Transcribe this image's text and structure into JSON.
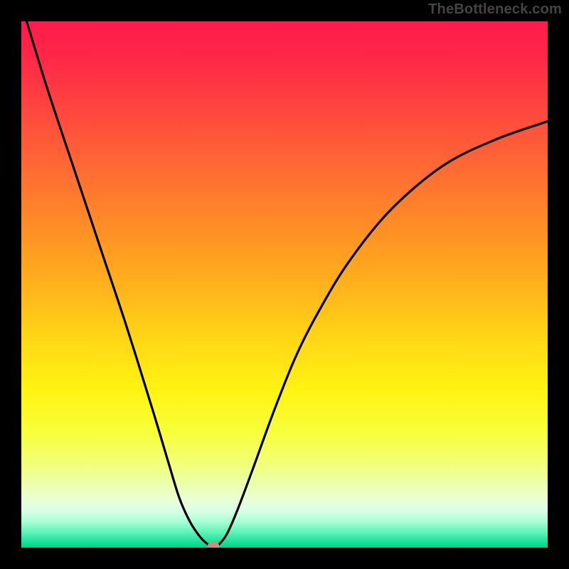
{
  "watermark": "TheBottleneck.com",
  "colors": {
    "page_bg": "#000000",
    "curve": "#000000",
    "marker": "#cf8a7a",
    "watermark_text": "#444444"
  },
  "chart_data": {
    "type": "line",
    "title": "",
    "xlabel": "",
    "ylabel": "",
    "xlim": [
      0,
      1
    ],
    "ylim": [
      0,
      1
    ],
    "grid": false,
    "legend": false,
    "series": [
      {
        "name": "curve",
        "x": [
          0.01,
          0.05,
          0.1,
          0.15,
          0.2,
          0.25,
          0.28,
          0.3,
          0.32,
          0.34,
          0.355,
          0.365,
          0.375,
          0.39,
          0.41,
          0.44,
          0.48,
          0.52,
          0.56,
          0.62,
          0.7,
          0.8,
          0.9,
          1.0
        ],
        "y": [
          1.0,
          0.87,
          0.72,
          0.57,
          0.42,
          0.26,
          0.16,
          0.095,
          0.05,
          0.02,
          0.006,
          0.002,
          0.006,
          0.025,
          0.07,
          0.15,
          0.26,
          0.36,
          0.44,
          0.54,
          0.64,
          0.725,
          0.775,
          0.81
        ]
      }
    ],
    "marker": {
      "x": 0.365,
      "y": 0.0
    }
  }
}
